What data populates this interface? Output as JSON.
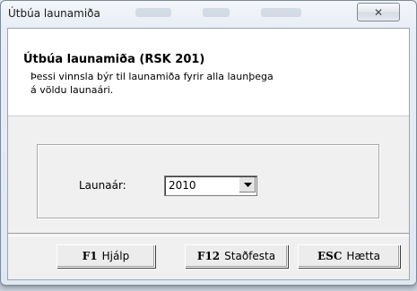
{
  "window": {
    "title": "Útbúa launamiða",
    "close_glyph": "✕"
  },
  "header": {
    "heading": "Útbúa launamiða (RSK 201)",
    "description_line1": "Þessi vinnsla býr til launamiða fyrir alla launþega",
    "description_line2": "á völdu launaári."
  },
  "form": {
    "year_label": "Launaár:",
    "year_value": "2010",
    "dropdown_icon": "chevron-down-icon"
  },
  "buttons": {
    "help": {
      "key": "F1",
      "label": "Hjálp"
    },
    "confirm": {
      "key": "F12",
      "label": "Staðfesta"
    },
    "cancel": {
      "key": "ESC",
      "label": "Hætta"
    }
  },
  "colors": {
    "window_frame": "#7a8a9a",
    "client_bg": "#f0f0f0",
    "header_bg": "#ffffff"
  }
}
